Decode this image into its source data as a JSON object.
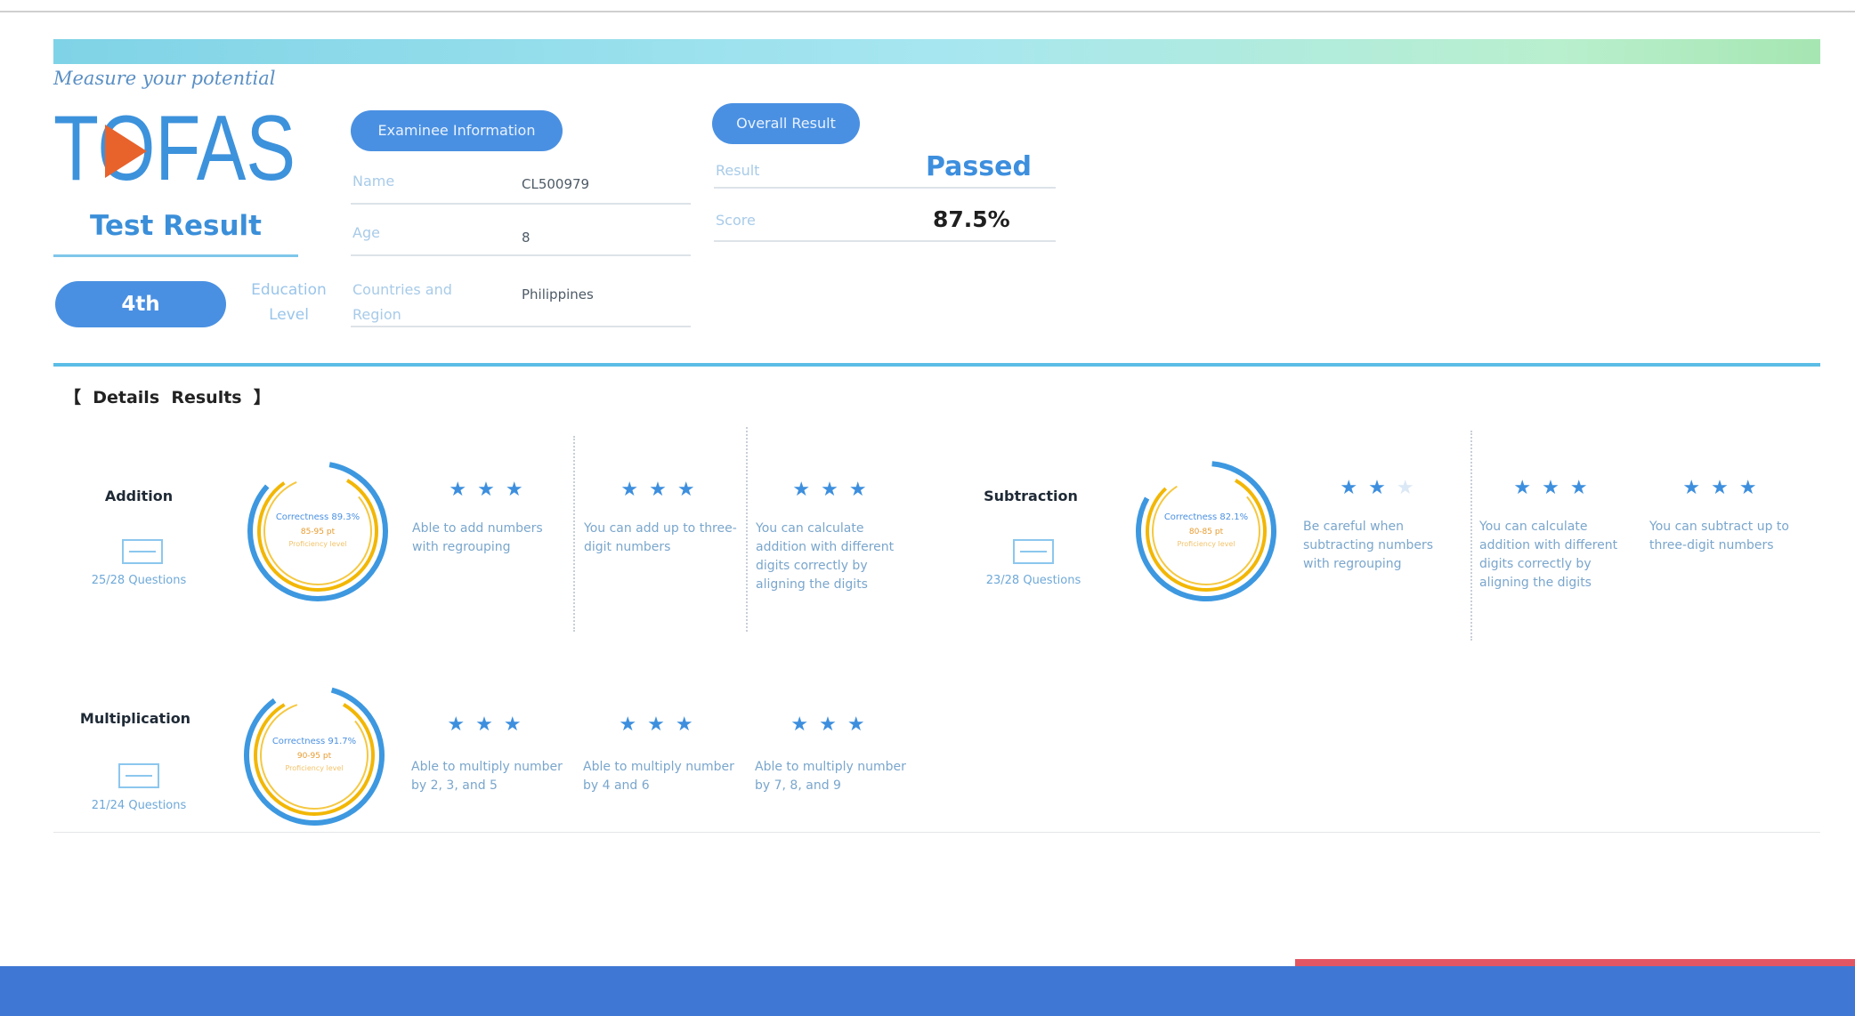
{
  "header": {
    "tagline": "Measure your potential",
    "brand": "TOFAS",
    "test_result": "Test Result",
    "grade": "4th",
    "education_label": "Education Level"
  },
  "examinee": {
    "button_label": "Examinee Information",
    "fields": [
      {
        "label": "Name",
        "value": "CL500979"
      },
      {
        "label": "Age",
        "value": "8"
      },
      {
        "label": "Countries and Region",
        "value": "Philippines"
      }
    ]
  },
  "overall": {
    "button_label": "Overall Result",
    "result_label": "Result",
    "result_value": "Passed",
    "score_label": "Score",
    "score_value": "87.5%"
  },
  "details_heading": "【  Details  Results  】",
  "skills": [
    {
      "name": "Addition",
      "questions": "25/28 Questions",
      "ring_text": [
        "Correctness 89.3%",
        "85-95 pt",
        "Proficiency level"
      ],
      "items": [
        {
          "rating": 3,
          "text": "Able to add numbers with regrouping"
        },
        {
          "rating": 3,
          "text": "You can add up to three-digit numbers"
        },
        {
          "rating": 3,
          "text": "You can calculate addition with different digits correctly by aligning the digits"
        }
      ]
    },
    {
      "name": "Subtraction",
      "questions": "23/28 Questions",
      "ring_text": [
        "Correctness 82.1%",
        "80-85 pt",
        "Proficiency level"
      ],
      "items": [
        {
          "rating": 2,
          "text": "Be careful when subtracting numbers with regrouping"
        },
        {
          "rating": 3,
          "text": "You can calculate addition with different digits correctly by aligning the digits"
        },
        {
          "rating": 3,
          "text": "You can subtract up to three-digit numbers"
        }
      ]
    },
    {
      "name": "Multiplication",
      "questions": "21/24 Questions",
      "ring_text": [
        "Correctness 91.7%",
        "90-95 pt",
        "Proficiency level"
      ],
      "items": [
        {
          "rating": 3,
          "text": "Able to multiply number by 2, 3, and 5"
        },
        {
          "rating": 3,
          "text": "Able to multiply number by 4 and 6"
        },
        {
          "rating": 3,
          "text": "Able to multiply number by 7, 8, and 9"
        }
      ]
    }
  ],
  "colors": {
    "accent": "#4a90e2",
    "ring_outer": "#3d98e0",
    "ring_inner": "#f2b705",
    "star": "#3d8fde",
    "footer": "#3e78d4",
    "footer_strip": "#e25663"
  }
}
